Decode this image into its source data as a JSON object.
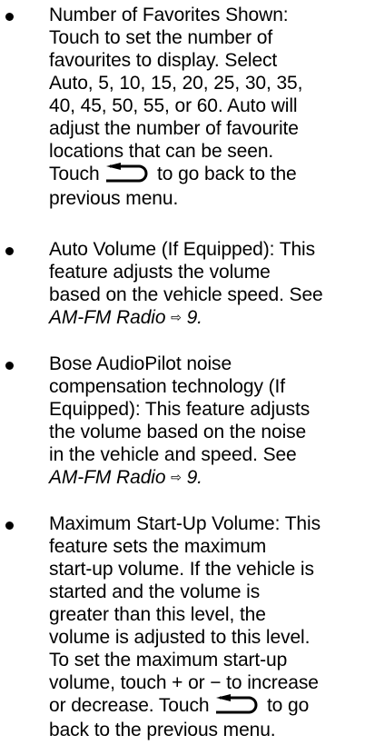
{
  "items": [
    {
      "lines": [
        "Number of Favorites Shown:",
        "Touch to set the number of",
        "favourites to display. Select",
        "Auto, 5, 10, 15, 20, 25, 30, 35,",
        "40, 45, 50, 55, or 60. Auto will",
        "adjust the number of favourite",
        "locations that can be seen."
      ],
      "touch_before": "Touch",
      "touch_after": "to go back to the",
      "last_line": "previous menu."
    },
    {
      "lines": [
        "Auto Volume (If Equipped): This",
        "feature adjusts the volume",
        "based on the vehicle speed. See"
      ],
      "ref_text": "AM-FM Radio",
      "ref_arrow": "⇨",
      "ref_page": "9",
      "ref_end": "."
    },
    {
      "lines": [
        "Bose AudioPilot noise",
        "compensation technology (If",
        "Equipped): This feature adjusts",
        "the volume based on the noise",
        "in the vehicle and speed. See"
      ],
      "ref_text": "AM-FM Radio",
      "ref_arrow": "⇨",
      "ref_page": "9",
      "ref_end": "."
    },
    {
      "lines": [
        "Maximum Start-Up Volume: This",
        "feature sets the maximum",
        "start-up volume. If the vehicle is",
        "started and the volume is",
        "greater than this level, the",
        "volume is adjusted to this level.",
        "To set the maximum start-up",
        "volume, touch + or − to increase"
      ],
      "touch_before": "or decrease. Touch",
      "touch_after": "to go",
      "last_line": "back to the previous menu."
    }
  ],
  "icons": {
    "back": "back-arrow-icon"
  }
}
